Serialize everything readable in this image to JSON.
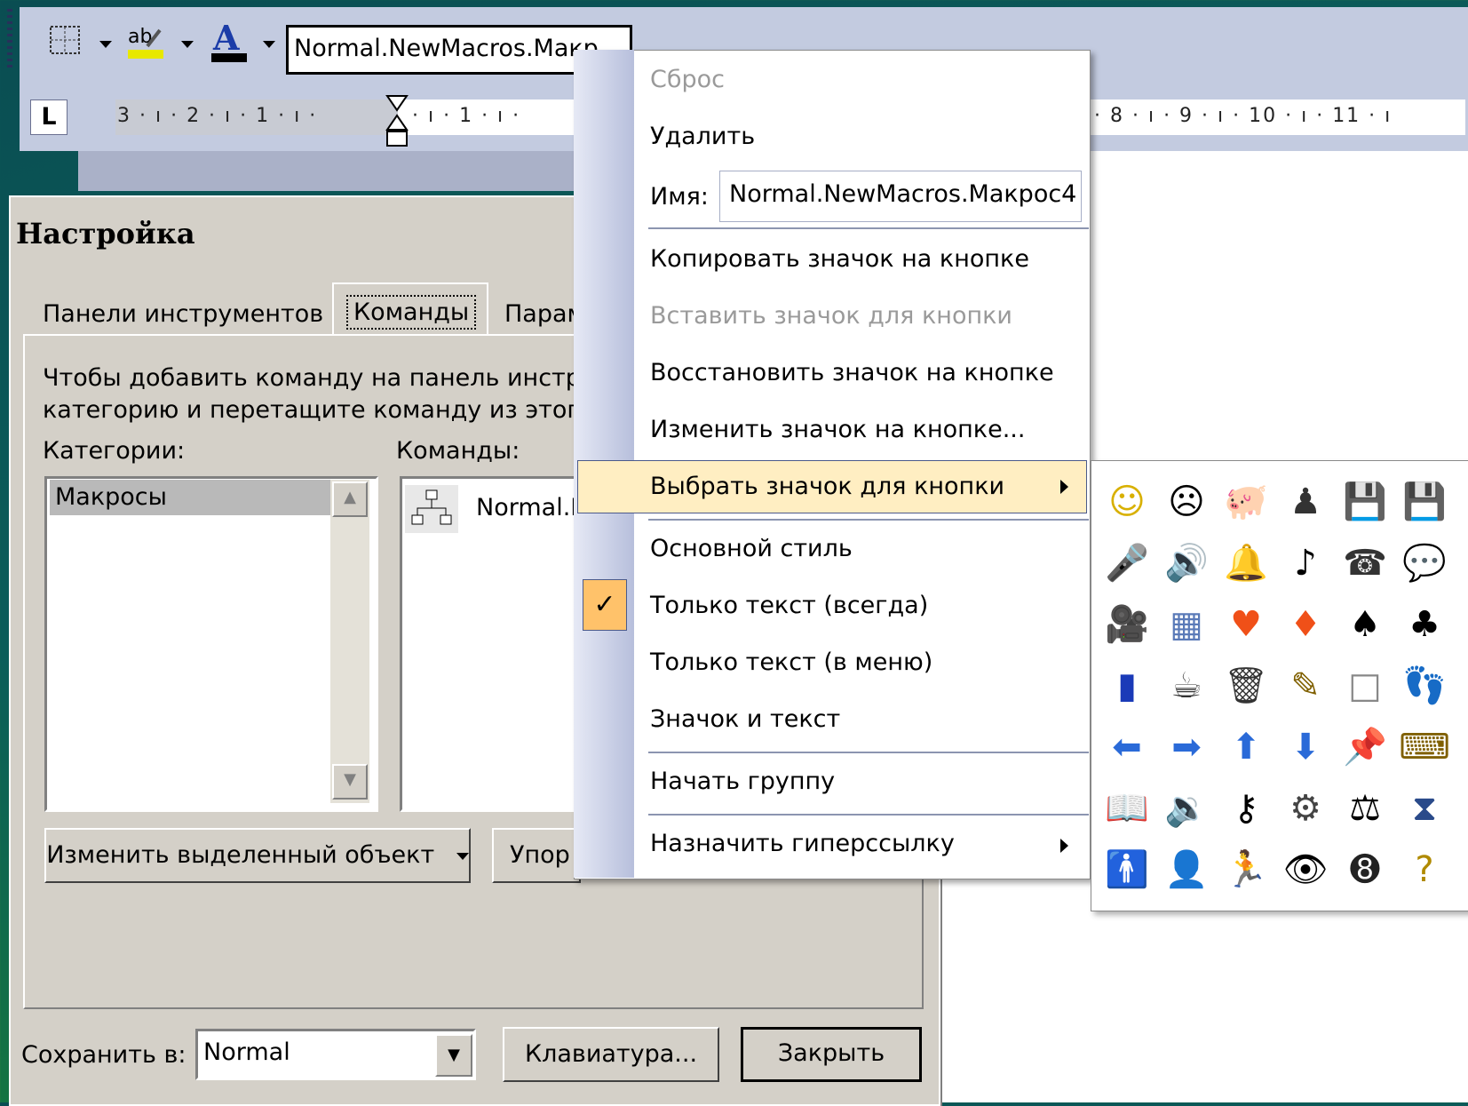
{
  "toolbar": {
    "combo_value": "Normal.NewMacros.Макр",
    "icons": [
      "border-icon",
      "highlight-icon",
      "font-color-icon"
    ]
  },
  "ruler": {
    "corner": "L",
    "left_ticks": "3 · ı · 2 · ı · 1 · ı ·",
    "mid_ticks": "· ı · 1 · ı ·",
    "right_ticks": "· 8 · ı · 9 · ı · 10 · ı · 11 · ı"
  },
  "dialog": {
    "title": "Настройка",
    "tabs": [
      "Панели инструментов",
      "Команды",
      "Парам"
    ],
    "instruction_line1": "Чтобы добавить команду на панель инстру",
    "instruction_line2": "категорию и перетащите команду из этого",
    "categories_label": "Категории:",
    "commands_label": "Команды:",
    "categories_selected": "Макросы",
    "command_item": "Normal.N",
    "modify_selection_button": "Изменить выделенный объект",
    "rearrange_button": "Упор",
    "save_in_label": "Сохранить в:",
    "save_in_value": "Normal",
    "keyboard_button": "Клавиатура...",
    "close_button": "Закрыть"
  },
  "context_menu": {
    "reset": "Сброс",
    "delete": "Удалить",
    "name_label": "Имя:",
    "name_value": "Normal.NewMacros.Макрос4",
    "copy_image": "Копировать значок на кнопке",
    "paste_image": "Вставить значок для кнопки",
    "restore_image": "Восстановить значок на кнопке",
    "edit_image": "Изменить значок на кнопке...",
    "choose_image": "Выбрать значок для кнопки",
    "default_style": "Основной стиль",
    "text_only_always": "Только текст (всегда)",
    "text_only_menus": "Только текст (в меню)",
    "image_and_text": "Значок и текст",
    "begin_group": "Начать группу",
    "assign_hyperlink": "Назначить гиперссылку"
  },
  "palette": {
    "rows": [
      [
        {
          "g": "☺",
          "n": "smiley-icon",
          "c": "#d8b000"
        },
        {
          "g": "☹",
          "n": "sad-face-icon",
          "c": "#000"
        },
        {
          "g": "🐖",
          "n": "piggy-bank-icon",
          "c": "#777"
        },
        {
          "g": "♟",
          "n": "pawn-icon",
          "c": "#333"
        },
        {
          "g": "💾",
          "n": "save-up-icon",
          "c": "#b08a00"
        },
        {
          "g": "💾",
          "n": "save-down-icon",
          "c": "#b08a00"
        }
      ],
      [
        {
          "g": "🎤",
          "n": "microphone-icon",
          "c": "#3a6ab0"
        },
        {
          "g": "🔊",
          "n": "speaker-icon",
          "c": "#b09000"
        },
        {
          "g": "🔔",
          "n": "bell-icon",
          "c": "#e0a800"
        },
        {
          "g": "♪",
          "n": "music-note-icon",
          "c": "#000"
        },
        {
          "g": "☎",
          "n": "telephone-icon",
          "c": "#333"
        },
        {
          "g": "💬",
          "n": "speech-bubble-icon",
          "c": "#000"
        }
      ],
      [
        {
          "g": "🎥",
          "n": "video-camera-icon",
          "c": "#444"
        },
        {
          "g": "▦",
          "n": "calculator-icon",
          "c": "#5a7ab8"
        },
        {
          "g": "♥",
          "n": "heart-icon",
          "c": "#f05018"
        },
        {
          "g": "♦",
          "n": "diamond-icon",
          "c": "#f05018"
        },
        {
          "g": "♠",
          "n": "spade-icon",
          "c": "#000"
        },
        {
          "g": "♣",
          "n": "club-icon",
          "c": "#000"
        }
      ],
      [
        {
          "g": "▮",
          "n": "jar-icon",
          "c": "#1a3ab8"
        },
        {
          "g": "☕",
          "n": "mug-icon",
          "c": "#333"
        },
        {
          "g": "🗑",
          "n": "trash-can-icon",
          "c": "#333"
        },
        {
          "g": "✎",
          "n": "pencil-icon",
          "c": "#806000"
        },
        {
          "g": "□",
          "n": "blank-square-icon",
          "c": "#888"
        },
        {
          "g": "👣",
          "n": "footprints-icon",
          "c": "#333"
        }
      ],
      [
        {
          "g": "⬅",
          "n": "arrow-left-icon",
          "c": "#2a6ad8"
        },
        {
          "g": "➡",
          "n": "arrow-right-icon",
          "c": "#2a6ad8"
        },
        {
          "g": "⬆",
          "n": "arrow-up-icon",
          "c": "#2a6ad8"
        },
        {
          "g": "⬇",
          "n": "arrow-down-icon",
          "c": "#2a6ad8"
        },
        {
          "g": "📌",
          "n": "pushpin-icon",
          "c": "#777"
        },
        {
          "g": "⌨",
          "n": "keyboard-icon",
          "c": "#806000"
        }
      ],
      [
        {
          "g": "📖",
          "n": "book-icon",
          "c": "#333"
        },
        {
          "g": "🔉",
          "n": "sound-wave-icon",
          "c": "#b09000"
        },
        {
          "g": "⚷",
          "n": "key-icon",
          "c": "#000"
        },
        {
          "g": "⚙",
          "n": "gears-icon",
          "c": "#444"
        },
        {
          "g": "⚖",
          "n": "scales-icon",
          "c": "#000"
        },
        {
          "g": "⧗",
          "n": "hourglass-icon",
          "c": "#2a4a8a"
        }
      ],
      [
        {
          "g": "🚹",
          "n": "person-icon",
          "c": "#000"
        },
        {
          "g": "👤",
          "n": "head-profile-icon",
          "c": "#000"
        },
        {
          "g": "🏃",
          "n": "runner-icon",
          "c": "#000"
        },
        {
          "g": "👁",
          "n": "eye-icon",
          "c": "#000"
        },
        {
          "g": "➑",
          "n": "eight-ball-icon",
          "c": "#222"
        },
        {
          "g": "?",
          "n": "question-mark-icon",
          "c": "#b08a00"
        }
      ]
    ]
  }
}
